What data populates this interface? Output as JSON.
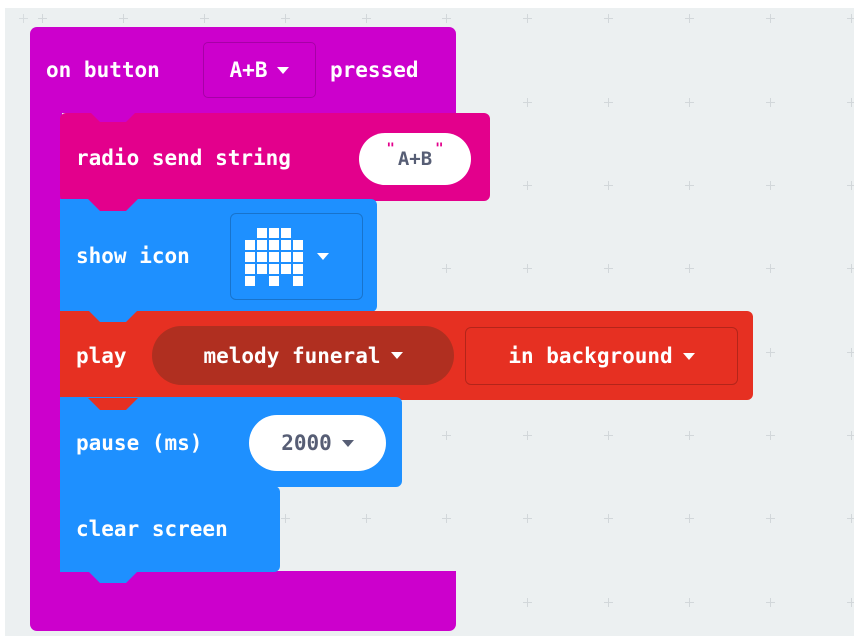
{
  "event": {
    "prefix": "on button",
    "button": "A+B",
    "suffix": "pressed",
    "color": "#cc00cc"
  },
  "radio_send": {
    "label": "radio send string",
    "value": "A+B",
    "color": "#e3008c"
  },
  "show_icon": {
    "label": "show icon",
    "icon": "led-matrix-icon",
    "leds": [
      [
        0,
        1,
        1,
        1,
        0
      ],
      [
        1,
        1,
        1,
        1,
        1
      ],
      [
        1,
        1,
        1,
        1,
        1
      ],
      [
        1,
        1,
        1,
        1,
        1
      ],
      [
        1,
        0,
        1,
        0,
        1
      ]
    ],
    "color": "#1e90ff"
  },
  "play": {
    "label": "play",
    "melody": "melody funeral",
    "mode": "in background",
    "color": "#e63022"
  },
  "pause": {
    "label": "pause (ms)",
    "value": "2000",
    "color": "#1e90ff"
  },
  "clear_screen": {
    "label": "clear screen",
    "color": "#1e90ff"
  }
}
